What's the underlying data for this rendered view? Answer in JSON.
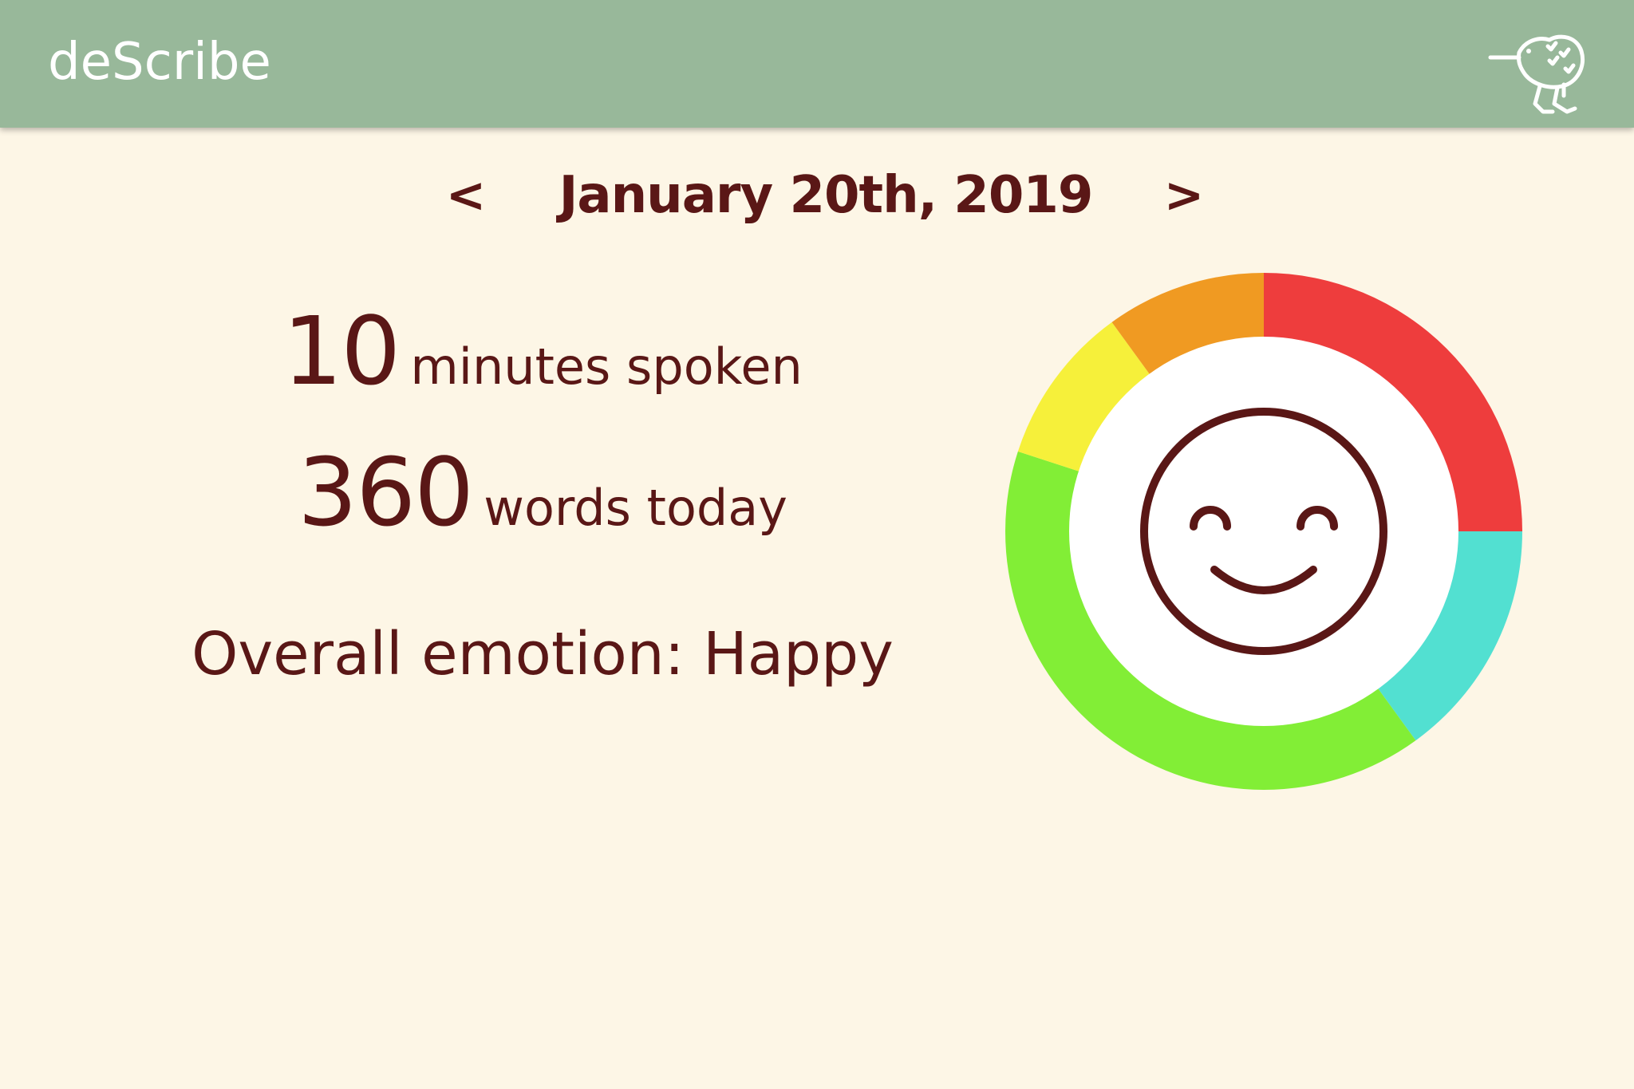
{
  "app": {
    "title": "deScribe",
    "mascot_icon": "kiwi-bird-icon"
  },
  "date_nav": {
    "prev_label": "<",
    "date": "January 20th, 2019",
    "next_label": ">"
  },
  "stats": {
    "minutes_value": "10",
    "minutes_label": "minutes spoken",
    "words_value": "360",
    "words_label": "words today",
    "emotion_text": "Overall emotion: Happy"
  },
  "emotion_icon": "smiley-face-icon",
  "colors": {
    "app_bar": "#98b89a",
    "background": "#fdf6e6",
    "text": "#5a1716",
    "segment_red": "#ee3d3d",
    "segment_teal": "#52e0d1",
    "segment_green": "#82ee36",
    "segment_yellow": "#f6f03a",
    "segment_orange": "#f09a22"
  },
  "chart_data": {
    "type": "pie",
    "values": [
      25,
      15,
      40,
      10,
      10
    ],
    "colors": [
      "#ee3d3d",
      "#52e0d1",
      "#82ee36",
      "#f6f03a",
      "#f09a22"
    ]
  }
}
